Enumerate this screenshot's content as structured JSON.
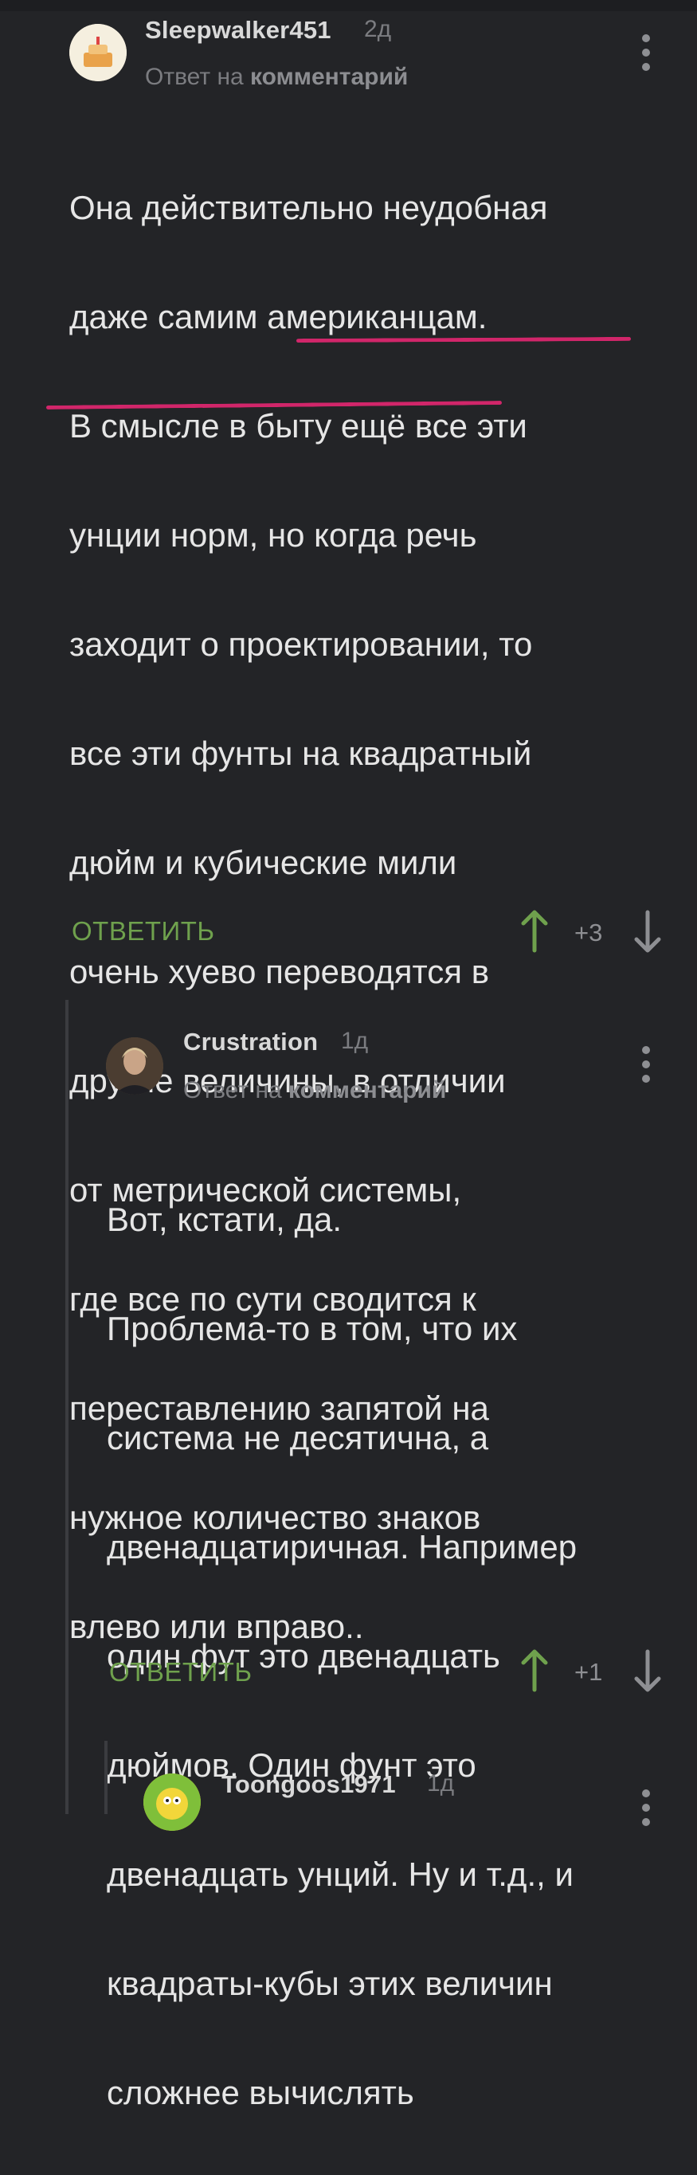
{
  "comments": [
    {
      "author": "Sleepwalker451",
      "time": "2д",
      "reply_prefix": "Ответ на",
      "reply_target": "комментарий",
      "lines": [
        "Она действительно неудобная",
        "даже самим американцам.",
        "В смысле в быту ещё все эти",
        "унции норм, но когда речь",
        "заходит о проектировании, то",
        "все эти фунты на квадратный",
        "дюйм и кубические мили",
        "очень хуево переводятся в",
        "другие величины, в отличии",
        "от метрической системы,",
        "где все по сути сводится к",
        "переставлению запятой на",
        "нужное количество знаков",
        "влево или вправо.."
      ],
      "reply_label": "ОТВЕТИТЬ",
      "rating": "+3"
    },
    {
      "author": "Crustration",
      "time": "1д",
      "reply_prefix": "Ответ на",
      "reply_target": "комментарий",
      "lines": [
        "Вот, кстати, да.",
        "Проблема-то в том, что их",
        "система не десятична, а",
        "двенадцатиричная. Например",
        "один фут это двенадцать",
        "дюймов. Один фунт это",
        "двенадцать унций. Ну и т.д., и",
        "квадраты-кубы этих величин",
        "сложнее вычислять"
      ],
      "reply_label": "ОТВЕТИТЬ",
      "rating": "+1"
    },
    {
      "author": "Toongoos1971",
      "time": "1д"
    }
  ],
  "colors": {
    "background": "#232427",
    "accent_green": "#6fa14d",
    "highlight": "#d1266a"
  }
}
